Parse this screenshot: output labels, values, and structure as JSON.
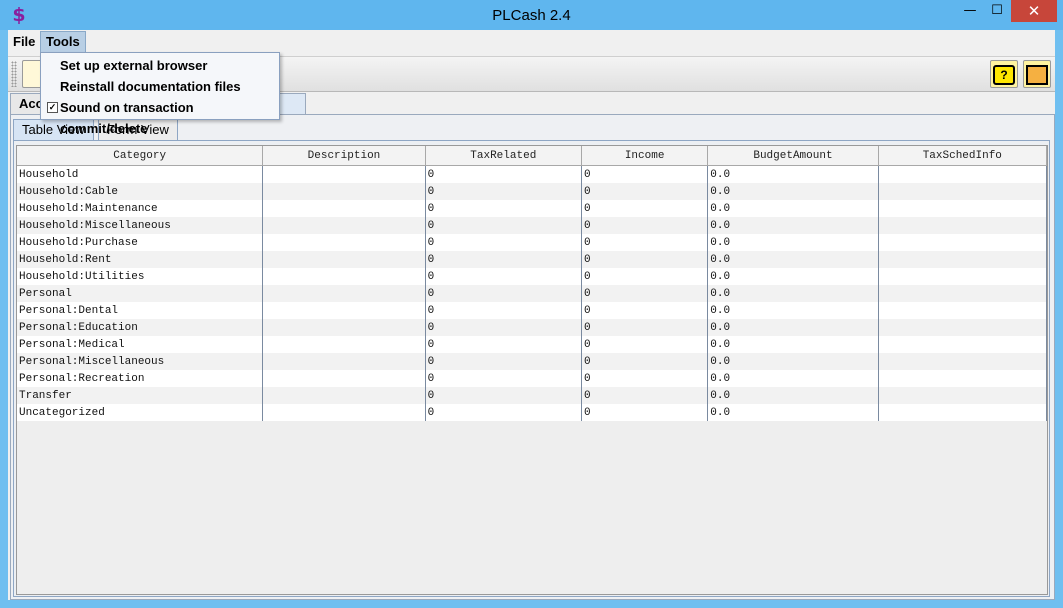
{
  "window": {
    "title": "PLCash 2.4",
    "app_icon": "dollar-sign-icon",
    "controls": {
      "minimize": "—",
      "maximize": "☐",
      "close": "✕"
    }
  },
  "menubar": {
    "file": "File",
    "tools": "Tools"
  },
  "tools_menu": {
    "items": [
      {
        "label": "Set up external browser"
      },
      {
        "label": "Reinstall documentation files"
      },
      {
        "label": "Sound on transaction commit/delete",
        "checked": true
      }
    ]
  },
  "toolbar": {
    "icons": [
      "new-item-icon",
      "help-icon",
      "exit-icon"
    ],
    "help_glyph": "?"
  },
  "outer_tabs": {
    "accounts": "Acco"
  },
  "inner_tabs": {
    "table_view": "Table View",
    "form_view": "Form View"
  },
  "table": {
    "columns": [
      "Category",
      "Description",
      "TaxRelated",
      "Income",
      "BudgetAmount",
      "TaxSchedInfo"
    ],
    "rows": [
      [
        "Household",
        "",
        "0",
        "0",
        "0.0",
        ""
      ],
      [
        "Household:Cable",
        "",
        "0",
        "0",
        "0.0",
        ""
      ],
      [
        "Household:Maintenance",
        "",
        "0",
        "0",
        "0.0",
        ""
      ],
      [
        "Household:Miscellaneous",
        "",
        "0",
        "0",
        "0.0",
        ""
      ],
      [
        "Household:Purchase",
        "",
        "0",
        "0",
        "0.0",
        ""
      ],
      [
        "Household:Rent",
        "",
        "0",
        "0",
        "0.0",
        ""
      ],
      [
        "Household:Utilities",
        "",
        "0",
        "0",
        "0.0",
        ""
      ],
      [
        "Personal",
        "",
        "0",
        "0",
        "0.0",
        ""
      ],
      [
        "Personal:Dental",
        "",
        "0",
        "0",
        "0.0",
        ""
      ],
      [
        "Personal:Education",
        "",
        "0",
        "0",
        "0.0",
        ""
      ],
      [
        "Personal:Medical",
        "",
        "0",
        "0",
        "0.0",
        ""
      ],
      [
        "Personal:Miscellaneous",
        "",
        "0",
        "0",
        "0.0",
        ""
      ],
      [
        "Personal:Recreation",
        "",
        "0",
        "0",
        "0.0",
        ""
      ],
      [
        "Transfer",
        "",
        "0",
        "0",
        "0.0",
        ""
      ],
      [
        "Uncategorized",
        "",
        "0",
        "0",
        "0.0",
        ""
      ]
    ]
  },
  "colors": {
    "titlebar": "#5fb6ee",
    "close_button": "#c7463a",
    "menu_highlight": "#b8cfe5"
  }
}
